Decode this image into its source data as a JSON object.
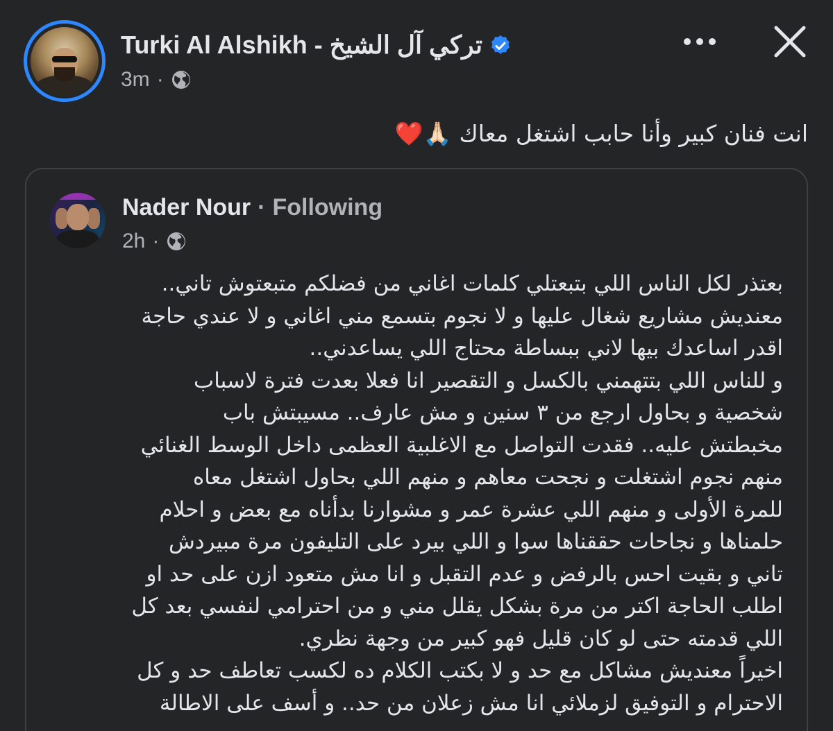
{
  "post": {
    "author_name": "Turki Al Alshikh - تركي آل الشيخ",
    "time": "3m",
    "separator": "·",
    "text": "انت فنان كبير وأنا حابب اشتغل معاك 🙏🏻❤️",
    "verified": true,
    "audience_icon": "globe-icon"
  },
  "shared_post": {
    "author_name": "Nader Nour",
    "separator": "·",
    "follow_status": "Following",
    "time": "2h",
    "audience_icon": "globe-icon",
    "lines": [
      "بعتذر لكل الناس اللي بتبعتلي كلمات اغاني من فضلكم متبعتوش تاني..",
      "معنديش مشاريع شغال عليها و لا نجوم بتسمع مني اغاني و لا عندي حاجة",
      "اقدر اساعدك بيها لاني ببساطة محتاج اللي يساعدني..",
      "و للناس اللي بتتهمني بالكسل و التقصير انا فعلا بعدت فترة لاسباب",
      "شخصية و بحاول ارجع من ٣ سنين و مش عارف.. مسيبتش باب",
      "مخبطتش عليه.. فقدت التواصل مع الاغلبية العظمى داخل الوسط الغنائي",
      "منهم نجوم اشتغلت و نجحت معاهم و منهم اللي بحاول اشتغل معاه",
      "للمرة الأولى و منهم اللي عشرة عمر و مشوارنا بدأناه مع بعض و احلام",
      "حلمناها و نجاحات حققناها سوا و اللي بيرد على التليفون مرة مبيردش",
      "تاني و بقيت احس بالرفض و عدم التقبل و انا مش متعود ازن على حد او",
      "اطلب الحاجة اكتر من مرة بشكل يقلل مني و من احترامي لنفسي بعد كل",
      "اللي قدمته حتى لو كان قليل فهو كبير من وجهة نظري.",
      "اخيراً معنديش مشاكل مع حد و لا بكتب الكلام ده لكسب تعاطف حد و كل",
      "الاحترام و التوفيق لزملائي انا مش زعلان من حد.. و أسف على الاطالة"
    ]
  },
  "colors": {
    "background": "#242526",
    "text_primary": "#e4e6eb",
    "text_secondary": "#b0b3b8",
    "verified_blue": "#2d88ff",
    "card_border": "#3e4042"
  }
}
